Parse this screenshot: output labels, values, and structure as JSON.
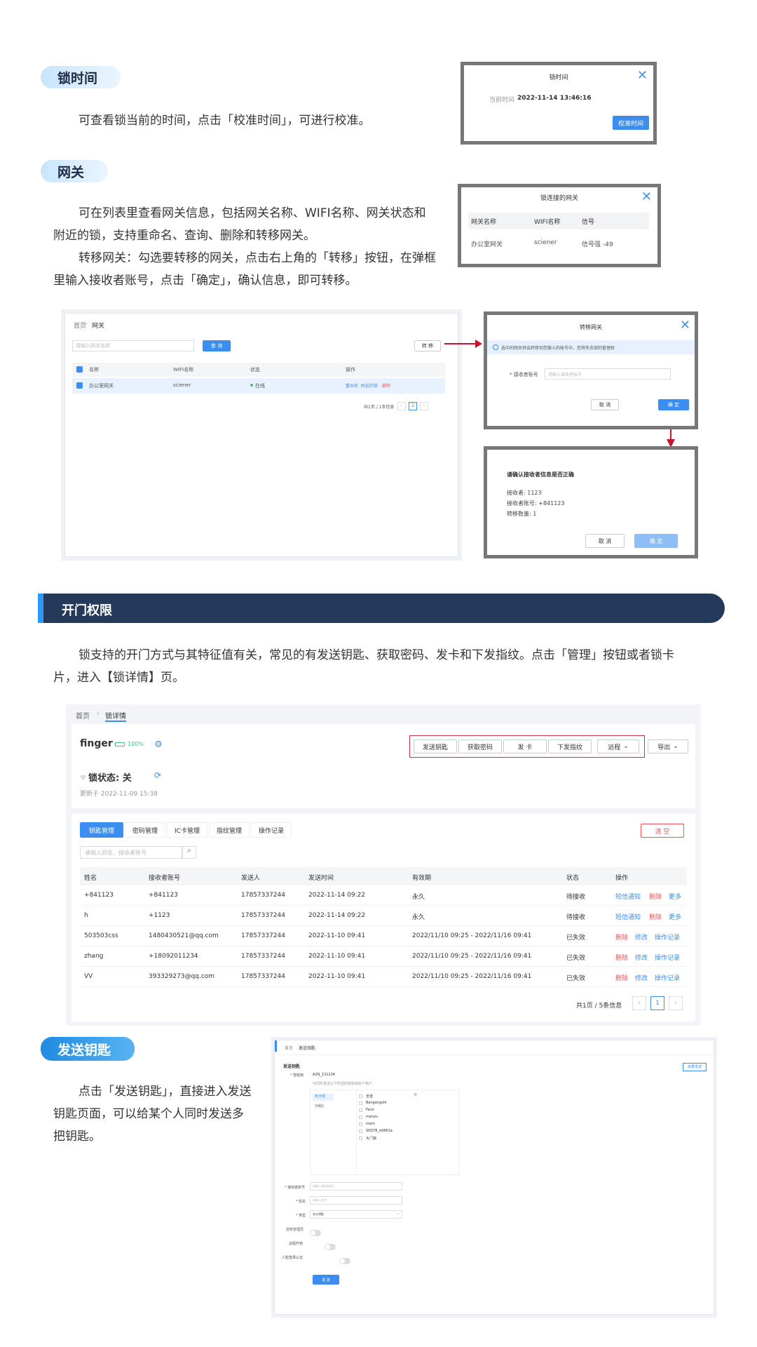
{
  "s1": {
    "title": "锁时间",
    "desc": "可查看锁当前的时间，点击「校准时间」，可进行校准。",
    "dialog": {
      "title": "锁时间",
      "label": "当前时间",
      "value": "2022-11-14 13:46:16",
      "button": "校准时间"
    }
  },
  "s2": {
    "title": "网关",
    "desc1a": "可在列表里查看网关信息，包括网关名称、WIFI名称、网关状态和",
    "desc1b": "附近的锁，支持重命名、查询、删除和转移网关。",
    "desc2a": "转移网关：勾选要转移的网关，点击右上角的「转移」按钮，在弹框",
    "desc2b": "里输入接收者账号，点击「确定」，确认信息，即可转移。",
    "conn": {
      "title": "锁连接的网关",
      "headers": [
        "网关名称",
        "WIFI名称",
        "信号"
      ],
      "row": [
        "办公室网关",
        "sciener",
        "信号强 -49"
      ]
    },
    "list": {
      "crumb_home": "首页",
      "crumb_cur": "网关",
      "search_placeholder": "请输入网关名称",
      "search_btn": "查 询",
      "transfer_btn": "转 移",
      "headers": [
        "名称",
        "WIFI名称",
        "状态",
        "操作"
      ],
      "row": {
        "name": "办公室网关",
        "wifi": "sciener",
        "status": "在线",
        "a1": "重命名",
        "a2": "附近的锁",
        "a3": "删除"
      },
      "pager": "共1页 / 1条信息",
      "page": "1"
    },
    "transfer": {
      "title": "转移网关",
      "notice": "选中的网关将会转移到您输入的账号中，您将失去锁的管理权",
      "label": "* 接收者账号",
      "placeholder": "请输入接收者账号",
      "cancel": "取 消",
      "ok": "确 定"
    },
    "confirm": {
      "title": "请确认接收者信息是否正确",
      "l1": "接收者: 1123",
      "l2": "接收者账号: +841123",
      "l3": "转移数量: 1",
      "cancel": "取 消",
      "ok": "确 定"
    }
  },
  "banner": {
    "title": "开门权限"
  },
  "s3": {
    "desc1": "锁支持的开门方式与其特征值有关，常见的有发送钥匙、获取密码、发卡和下发指纹。点击「管理」按钮或者锁卡",
    "desc2": "片，进入【锁详情】页。",
    "detail": {
      "crumb_home": "首页",
      "crumb_cur": "锁详情",
      "lock_name": "finger",
      "battery": "100%",
      "lock_state": "锁状态: 关",
      "updated": "更新于 2022-11-09 15:38",
      "actions": [
        "发送钥匙",
        "获取密码",
        "发 卡",
        "下发指纹",
        "远程"
      ],
      "export": "导出",
      "tabs": [
        "钥匙管理",
        "密码管理",
        "IC卡管理",
        "指纹管理",
        "操作记录"
      ],
      "clear": "清 空",
      "search_placeholder": "请输入别名、接收者账号",
      "headers": [
        "姓名",
        "接收者账号",
        "发送人",
        "发送时间",
        "有效期",
        "状态",
        "操作"
      ],
      "rows": [
        {
          "name": "+841123",
          "acct": "+841123",
          "sender": "17857337244",
          "time": "2022-11-14 09:22",
          "valid": "永久",
          "status": "待接收",
          "o1": "短信通知",
          "o2": "删除",
          "o3": "更多"
        },
        {
          "name": "h",
          "acct": "+1123",
          "sender": "17857337244",
          "time": "2022-11-14 09:22",
          "valid": "永久",
          "status": "待接收",
          "o1": "短信通知",
          "o2": "删除",
          "o3": "更多"
        },
        {
          "name": "503503css",
          "acct": "1480430521@qq.com",
          "sender": "17857337244",
          "time": "2022-11-10 09:41",
          "valid": "2022/11/10 09:25 - 2022/11/16 09:41",
          "status": "已失效",
          "o1": "删除",
          "o2": "修改",
          "o3": "操作记录"
        },
        {
          "name": "zhang",
          "acct": "+18092011234",
          "sender": "17857337244",
          "time": "2022-11-10 09:41",
          "valid": "2022/11/10 09:25 - 2022/11/16 09:41",
          "status": "已失效",
          "o1": "删除",
          "o2": "修改",
          "o3": "操作记录"
        },
        {
          "name": "VV",
          "acct": "393329273@qq.com",
          "sender": "17857337244",
          "time": "2022-11-10 09:41",
          "valid": "2022/11/10 09:25 - 2022/11/16 09:41",
          "status": "已失效",
          "o1": "删除",
          "o2": "修改",
          "o3": "操作记录"
        }
      ],
      "pager": "共1页 / 5条信息",
      "page": "1"
    }
  },
  "s4": {
    "title": "发送钥匙",
    "desc1": "点击「发送钥匙」，直接进入发送",
    "desc2": "钥匙页面，可以给某个人同时发送多",
    "desc3": "把钥匙。",
    "form": {
      "crumb_home": "首页",
      "crumb_cur": "发送钥匙",
      "heading": "发送钥匙",
      "batch_btn": "批量发送",
      "lock_label": "* 智能锁",
      "lock_value": "A2N_131234",
      "lock_hint": "可同时发送以下所选的智能锁给个用户",
      "groups": [
        "未分组",
        "分组1"
      ],
      "locks": [
        "全选",
        "Bangongshi",
        "Face",
        "menzu",
        "room",
        "SN378_ed961a",
        "大门锁"
      ],
      "f_acct": "* 接收者账号",
      "f_acct_ph": "请输入接收者账号",
      "f_name": "* 姓名",
      "f_name_ph": "请输入姓名",
      "f_type": "* 类型",
      "f_type_val": "永久钥匙",
      "t1": "授权管理员",
      "t2": "远程开锁",
      "t3": "人脸登录认证",
      "send": "发 送"
    }
  }
}
